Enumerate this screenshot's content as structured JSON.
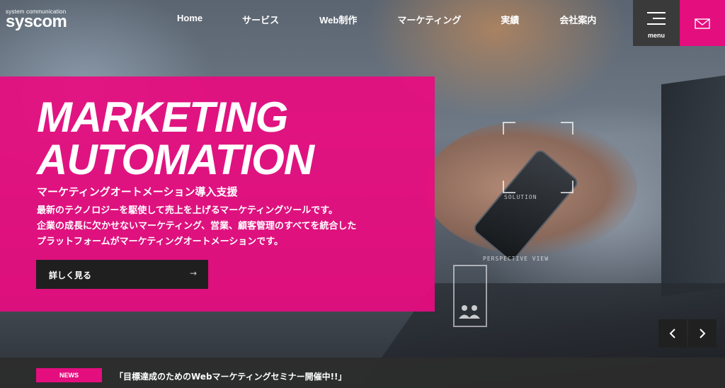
{
  "header": {
    "logo_sub": "system communication",
    "logo_main": "syscom",
    "nav": [
      "Home",
      "サービス",
      "Web制作",
      "マーケティング",
      "実績",
      "会社案内"
    ],
    "menu_label": "menu",
    "menu_icon": "hamburger-icon",
    "mail_icon": "mail-icon"
  },
  "hero": {
    "headline_line1": "MARKETING",
    "headline_line2": "AUTOMATION",
    "subtitle": "マーケティングオートメーション導入支援",
    "description": [
      "最新のテクノロジーを駆使して売上を上げるマーケティングツールです。",
      "企業の成長に欠かせないマーケティング、営業、顧客管理のすべてを統合した",
      "プラットフォームがマーケティングオートメーションです。"
    ],
    "button_label": "詳しく見る",
    "button_arrow": "→",
    "hud_solution": "SOLUTION",
    "hud_perspective": "PERSPECTIVE VIEW"
  },
  "slider": {
    "prev_icon": "chevron-left-icon",
    "next_icon": "chevron-right-icon"
  },
  "news": {
    "badge": "NEWS",
    "text": "「目標達成のためのWebマーケティングセミナー開催中!!」"
  },
  "colors": {
    "accent": "#e40e7f",
    "dark": "#1f1f1f"
  }
}
